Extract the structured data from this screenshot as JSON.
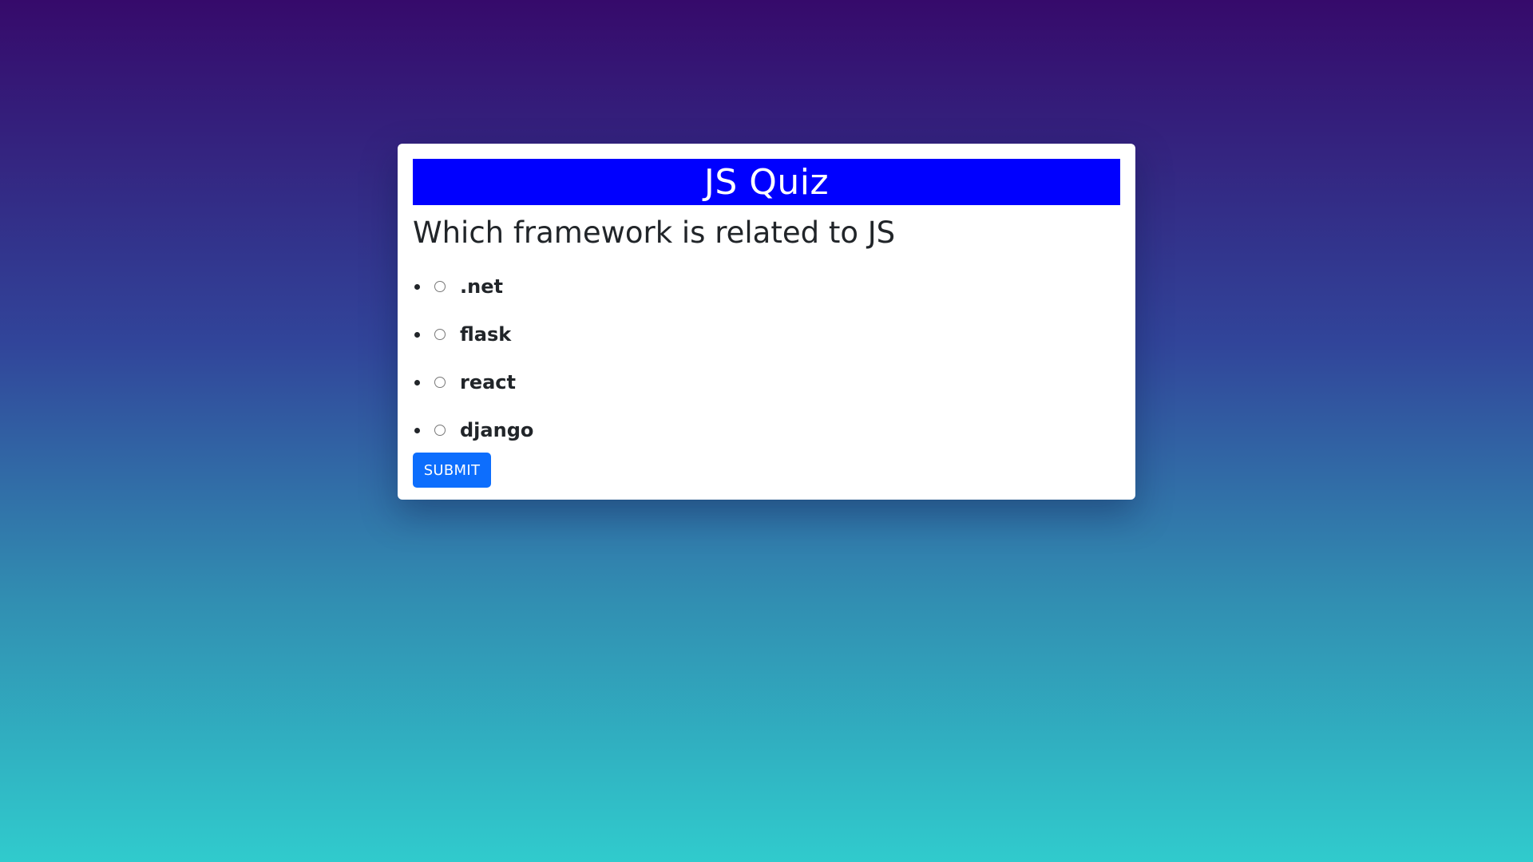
{
  "quiz": {
    "title": "JS Quiz",
    "question": "Which framework is related to JS",
    "options": [
      {
        "label": ".net"
      },
      {
        "label": "flask"
      },
      {
        "label": "react"
      },
      {
        "label": "django"
      }
    ],
    "submit_label": "SUBMIT"
  },
  "colors": {
    "header_bg": "#0000ff",
    "button_bg": "#0d6efd",
    "card_bg": "#ffffff",
    "gradient_top": "#360a6b",
    "gradient_bottom": "#30cbcd"
  }
}
